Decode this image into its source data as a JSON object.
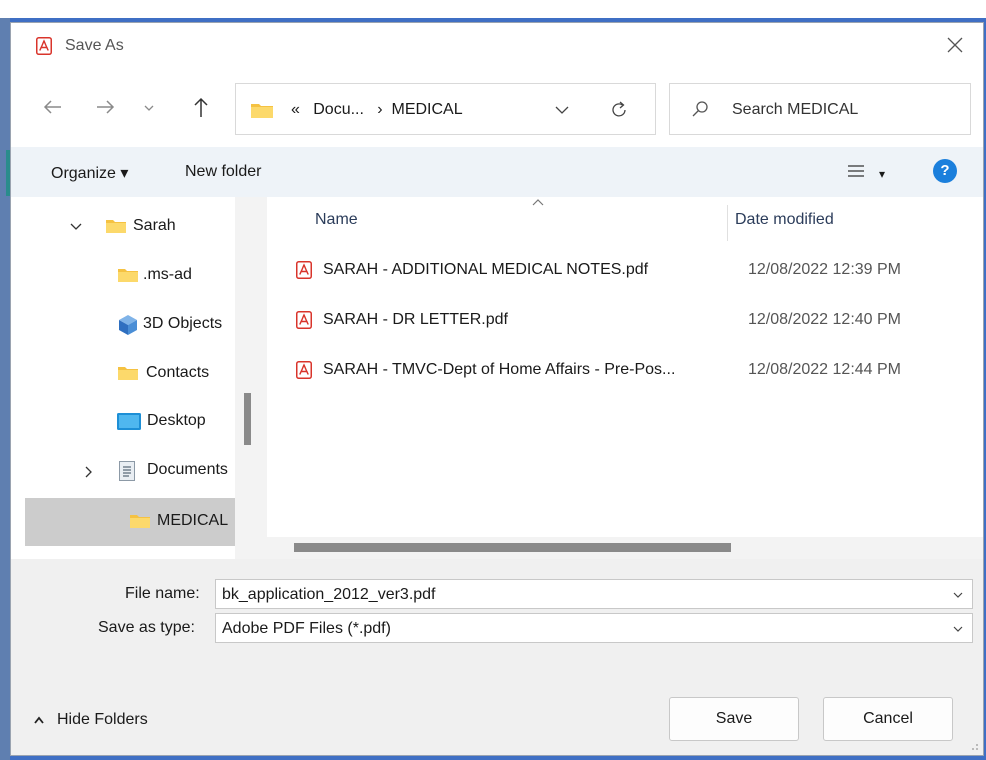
{
  "dialog": {
    "title": "Save As"
  },
  "nav": {
    "address": {
      "overflow": "«",
      "parent": "Docu...",
      "separator": "›",
      "current": "MEDICAL"
    },
    "search_placeholder": "Search MEDICAL"
  },
  "toolbar": {
    "organize": "Organize ▾",
    "new_folder": "New folder",
    "view_caret": "▾",
    "help": "?"
  },
  "tree": {
    "items": [
      {
        "label": "Sarah",
        "icon": "folder-icon"
      },
      {
        "label": ".ms-ad",
        "icon": "folder-icon"
      },
      {
        "label": "3D Objects",
        "icon": "cube-icon"
      },
      {
        "label": "Contacts",
        "icon": "folder-icon"
      },
      {
        "label": "Desktop",
        "icon": "desktop-icon"
      },
      {
        "label": "Documents",
        "icon": "documents-icon"
      },
      {
        "label": "MEDICAL",
        "icon": "folder-icon"
      }
    ]
  },
  "list": {
    "columns": {
      "name": "Name",
      "date": "Date modified"
    },
    "rows": [
      {
        "name": "SARAH - ADDITIONAL MEDICAL NOTES.pdf",
        "date": "12/08/2022 12:39 PM"
      },
      {
        "name": "SARAH - DR LETTER.pdf",
        "date": "12/08/2022 12:40 PM"
      },
      {
        "name": "SARAH - TMVC-Dept of Home Affairs - Pre-Pos...",
        "date": "12/08/2022 12:44 PM"
      }
    ]
  },
  "form": {
    "file_name_label": "File name:",
    "file_name_value": "bk_application_2012_ver3.pdf",
    "type_label": "Save as type:",
    "type_value": "Adobe PDF Files (*.pdf)"
  },
  "footer": {
    "hide_folders": "Hide Folders",
    "save": "Save",
    "cancel": "Cancel"
  },
  "colors": {
    "accent": "#1b7fdc",
    "pdf_red": "#d9342b",
    "folder": "#f5c242",
    "selection": "#cccccc",
    "toolbar_bg": "#eef3f8"
  }
}
